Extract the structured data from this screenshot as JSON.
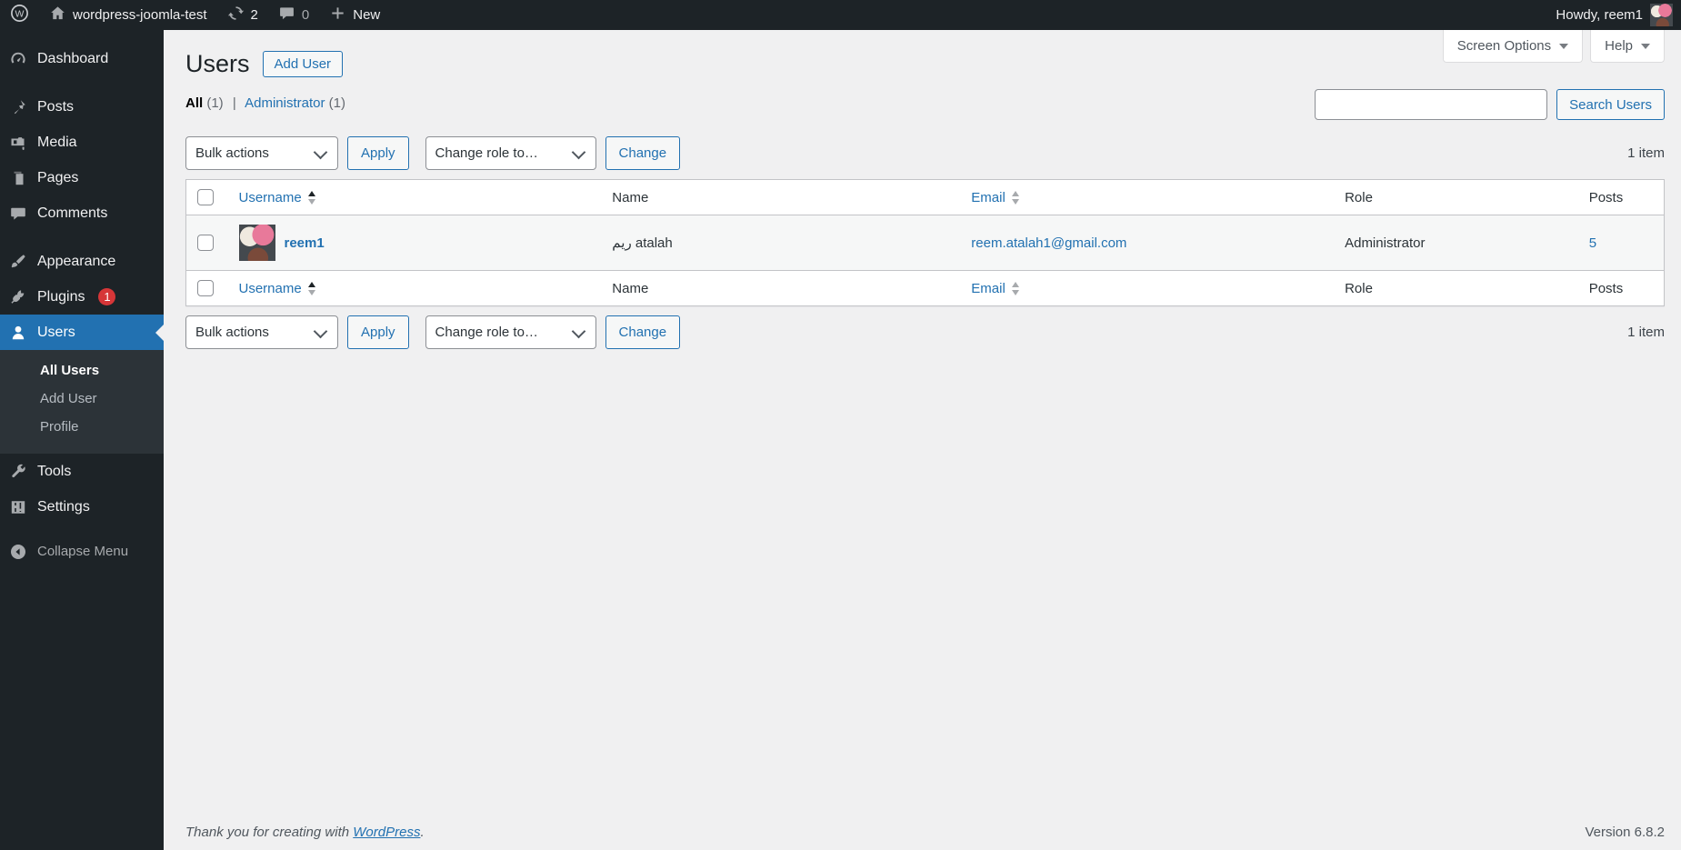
{
  "admin_bar": {
    "site_name": "wordpress-joomla-test",
    "updates_count": "2",
    "comments_count": "0",
    "new_label": "New",
    "howdy": "Howdy, reem1"
  },
  "sidebar": {
    "items": [
      {
        "label": "Dashboard"
      },
      {
        "label": "Posts"
      },
      {
        "label": "Media"
      },
      {
        "label": "Pages"
      },
      {
        "label": "Comments"
      },
      {
        "label": "Appearance"
      },
      {
        "label": "Plugins",
        "badge": "1"
      },
      {
        "label": "Users"
      },
      {
        "label": "Tools"
      },
      {
        "label": "Settings"
      }
    ],
    "users_submenu": [
      "All Users",
      "Add User",
      "Profile"
    ],
    "collapse_label": "Collapse Menu"
  },
  "page": {
    "title": "Users",
    "add_user_label": "Add User",
    "screen_options_label": "Screen Options",
    "help_label": "Help",
    "views": {
      "all": "All",
      "all_count": "(1)",
      "sep": "|",
      "administrator": "Administrator",
      "administrator_count": "(1)"
    },
    "search_button": "Search Users",
    "tablenav": {
      "bulk_actions": "Bulk actions",
      "apply": "Apply",
      "change_role": "Change role to…",
      "change": "Change",
      "count": "1 item"
    }
  },
  "table": {
    "headers": {
      "username": "Username",
      "name": "Name",
      "email": "Email",
      "role": "Role",
      "posts": "Posts"
    },
    "rows": [
      {
        "username": "reem1",
        "name": "ريم atalah",
        "email": "reem.atalah1@gmail.com",
        "role": "Administrator",
        "posts": "5"
      }
    ]
  },
  "footer": {
    "thanks_prefix": "Thank you for creating with ",
    "wordpress_link": "WordPress",
    "thanks_suffix": ".",
    "version": "Version 6.8.2"
  },
  "colors": {
    "accent": "#2271b1",
    "admin_bar_bg": "#1d2327",
    "submenu_bg": "#2c3338",
    "badge_bg": "#d63638",
    "content_bg": "#f0f0f1",
    "striped_row": "#f6f7f7"
  }
}
